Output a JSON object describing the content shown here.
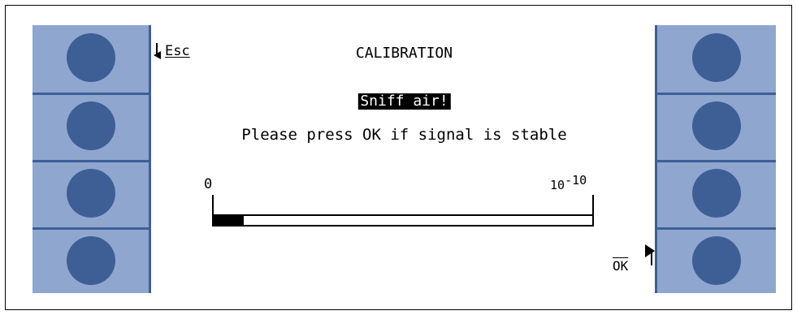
{
  "screen": {
    "title": "CALIBRATION",
    "esc_label": "Esc",
    "highlight": "Sniff air!",
    "message": "Please press OK if signal is stable",
    "scale_min": "0",
    "scale_max_base": "10",
    "scale_max_exp": "-10",
    "ok_label": "OK",
    "signal_level_fraction": 0.08
  },
  "colors": {
    "panel": "#8fa7cf",
    "key": "#3e5f96",
    "screen_bg": "#ffffff",
    "text": "#000000"
  },
  "icons": {
    "esc": "arrow-left-icon",
    "ok": "arrow-right-icon"
  }
}
